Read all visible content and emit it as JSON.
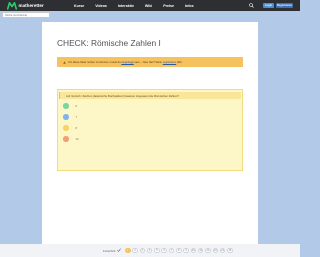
{
  "brand": {
    "name": "matheretter",
    "color": "#2ecc71"
  },
  "nav": {
    "links": [
      "Kurse",
      "Videos",
      "Interaktiv",
      "Wiki",
      "Preise",
      "Infos"
    ],
    "login_label": "Login",
    "register_label": "Registrieren"
  },
  "search": {
    "placeholder": "Suche (Lernthema)"
  },
  "page": {
    "title": "CHECK: Römische Zahlen I"
  },
  "notice": {
    "text": "Um diese Seite nutzen zu können, musst du",
    "link1": "eingeloggt",
    "middle": "sein. – Neu hier?",
    "link2_prefix": "Dann",
    "link2": "registrieren",
    "suffix": "dich."
  },
  "quiz": {
    "question": "Auf römisch: Zeichen (lateinische Buchstaben) basieren insgesamt die Römischen Zahlen?",
    "options": [
      {
        "label": "6",
        "color": "#7fd3a0"
      },
      {
        "label": "7",
        "color": "#7fb6e8"
      },
      {
        "label": "8",
        "color": "#f6d36a"
      },
      {
        "label": "10",
        "color": "#f1a07a"
      }
    ]
  },
  "footer": {
    "label": "Fortschritt",
    "steps": [
      "1",
      "2",
      "3",
      "4",
      "5",
      "6",
      "7",
      "8",
      "9",
      "10",
      "11",
      "12",
      "13",
      "14",
      "15"
    ],
    "active_step": 1
  }
}
